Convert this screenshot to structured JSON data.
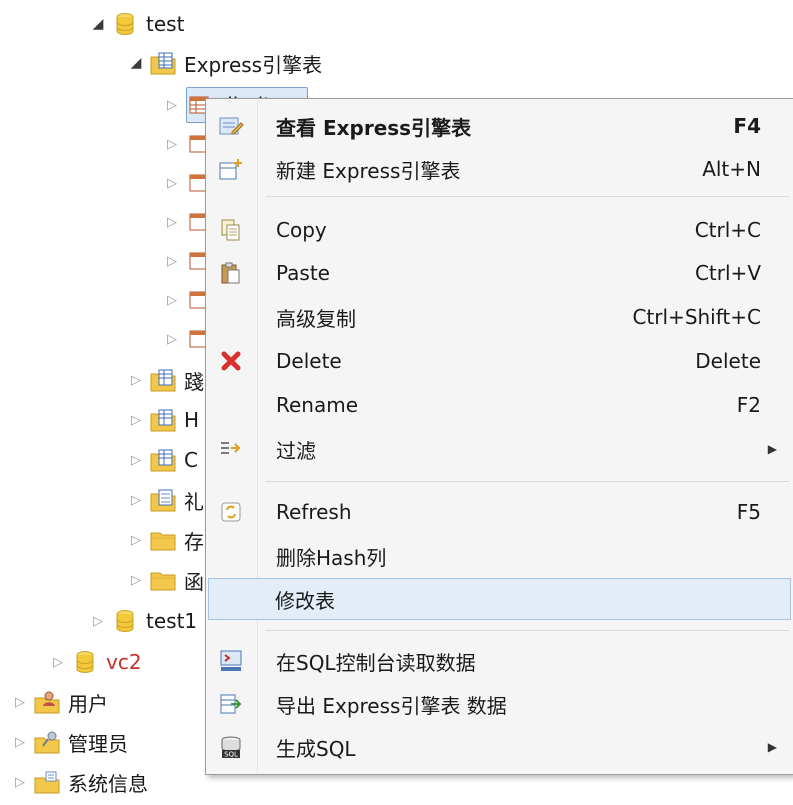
{
  "tree": {
    "db_test": "test",
    "express_folder": "Express引擎表",
    "selected_item_partial": "dimit",
    "collapsed_children_count": 6,
    "folder_partials": [
      "踐",
      "H",
      "C",
      "礼",
      "存",
      "函"
    ],
    "db_test1_partial": "test1",
    "db_vc2": "vc2",
    "users": "用户",
    "admins": "管理员",
    "sysinfo": "系统信息"
  },
  "menu": {
    "items": [
      {
        "label": "查看 Express引擎表",
        "shortcut": "F4",
        "icon": "view-edit-icon"
      },
      {
        "label": "新建 Express引擎表",
        "shortcut": "Alt+N",
        "icon": "new-table-icon"
      },
      {
        "label": "Copy",
        "shortcut": "Ctrl+C",
        "icon": "copy-icon"
      },
      {
        "label": "Paste",
        "shortcut": "Ctrl+V",
        "icon": "paste-icon"
      },
      {
        "label": "高级复制",
        "shortcut": "Ctrl+Shift+C"
      },
      {
        "label": "Delete",
        "shortcut": "Delete",
        "icon": "delete-icon"
      },
      {
        "label": "Rename",
        "shortcut": "F2"
      },
      {
        "label": "过滤",
        "icon": "filter-icon"
      },
      {
        "label": "Refresh",
        "shortcut": "F5",
        "icon": "refresh-icon"
      },
      {
        "label": "删除Hash列"
      },
      {
        "label": "修改表"
      },
      {
        "label": "在SQL控制台读取数据",
        "icon": "sql-console-icon"
      },
      {
        "label": "导出 Express引擎表 数据",
        "icon": "export-icon"
      },
      {
        "label": "生成SQL",
        "icon": "generate-sql-icon"
      }
    ],
    "colors": {
      "hover": "#e3edf8",
      "delete_red": "#d9312b",
      "db_yellow": "#f3c93a"
    }
  }
}
